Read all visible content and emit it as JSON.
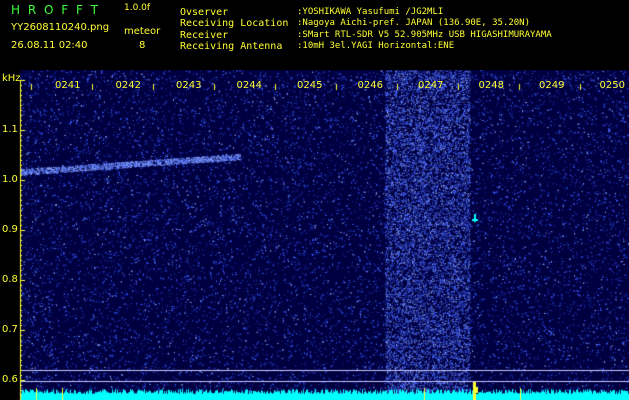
{
  "header": {
    "app_title": "H R O F F T",
    "version": "1.0.0f",
    "filename": "YY2608110240.png",
    "datetime": "26.08.11 02:40",
    "mode_label": "meteor",
    "meteor_count": "8",
    "info": [
      {
        "label": "Ovserver",
        "value": ":YOSHIKAWA Yasufumi /JG2MLI"
      },
      {
        "label": "Receiving Location",
        "value": ":Nagoya Aichi-pref. JAPAN (136.90E, 35.20N)"
      },
      {
        "label": "Receiver",
        "value": ":SMart RTL-SDR V5 52.905MHz USB HIGASHIMURAYAMA"
      },
      {
        "label": "Receiving Antenna",
        "value": ":10mH 3el.YAGI Horizontal:ENE"
      }
    ]
  },
  "chart_data": {
    "type": "heatmap",
    "y_unit": "kHz",
    "y_ticks": [
      "1.1",
      "1.0",
      "0.9",
      "0.8",
      "0.7",
      "0.6"
    ],
    "ylim": [
      0.58,
      1.2
    ],
    "x_ticks": [
      "0241",
      "0242",
      "0243",
      "0244",
      "0245",
      "0246",
      "0247",
      "0248",
      "0249",
      "0250"
    ],
    "colors": {
      "background": "#000040",
      "signal": "#3c5cff",
      "echo": "#00ffff",
      "label": "#ffff33"
    }
  }
}
